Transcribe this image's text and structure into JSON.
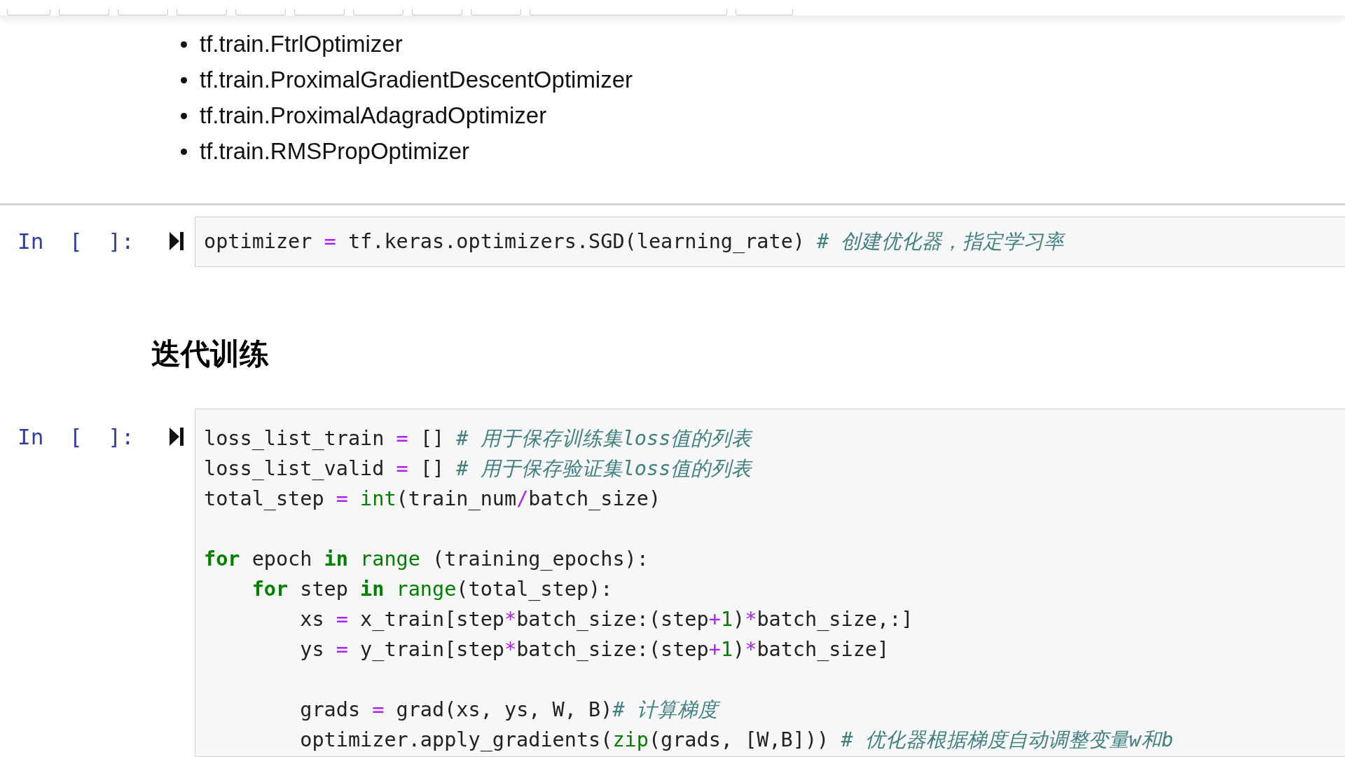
{
  "markdown_cell": {
    "bullets": [
      "tf.train.FtrlOptimizer",
      "tf.train.ProximalGradientDescentOptimizer",
      "tf.train.ProximalAdagradOptimizer",
      "tf.train.RMSPropOptimizer"
    ]
  },
  "cells": [
    {
      "kind": "code",
      "prompt": "In [ ]:",
      "lines": [
        {
          "kind": "code",
          "tokens": [
            {
              "kind": "plain",
              "s": "optimizer "
            },
            {
              "kind": "op",
              "s": "="
            },
            {
              "kind": "plain",
              "s": " tf.keras.optimizers.SGD(learning_rate) "
            },
            {
              "kind": "comment",
              "s": "# 创建优化器，指定学习率"
            }
          ]
        }
      ]
    },
    {
      "kind": "heading",
      "text": "迭代训练"
    },
    {
      "kind": "code",
      "prompt": "In [ ]:",
      "lines": [
        {
          "kind": "code",
          "tokens": [
            {
              "kind": "plain",
              "s": "loss_list_train "
            },
            {
              "kind": "op",
              "s": "="
            },
            {
              "kind": "plain",
              "s": " [] "
            },
            {
              "kind": "comment",
              "s": "# 用于保存训练集loss值的列表"
            }
          ]
        },
        {
          "kind": "code",
          "tokens": [
            {
              "kind": "plain",
              "s": "loss_list_valid "
            },
            {
              "kind": "op",
              "s": "="
            },
            {
              "kind": "plain",
              "s": " [] "
            },
            {
              "kind": "comment",
              "s": "# 用于保存验证集loss值的列表"
            }
          ]
        },
        {
          "kind": "code",
          "tokens": [
            {
              "kind": "plain",
              "s": "total_step "
            },
            {
              "kind": "op",
              "s": "="
            },
            {
              "kind": "builtin",
              "s": " int"
            },
            {
              "kind": "plain",
              "s": "(train_num"
            },
            {
              "kind": "op",
              "s": "/"
            },
            {
              "kind": "plain",
              "s": "batch_size)"
            }
          ]
        },
        {
          "kind": "blank"
        },
        {
          "kind": "code",
          "tokens": [
            {
              "kind": "keyword",
              "s": "for"
            },
            {
              "kind": "plain",
              "s": " epoch "
            },
            {
              "kind": "keyword",
              "s": "in"
            },
            {
              "kind": "builtin",
              "s": " range"
            },
            {
              "kind": "plain",
              "s": " (training_epochs):"
            }
          ]
        },
        {
          "kind": "code",
          "tokens": [
            {
              "kind": "keyword",
              "s": "    for"
            },
            {
              "kind": "plain",
              "s": " step "
            },
            {
              "kind": "keyword",
              "s": "in"
            },
            {
              "kind": "builtin",
              "s": " range"
            },
            {
              "kind": "plain",
              "s": "(total_step):"
            }
          ]
        },
        {
          "kind": "code",
          "tokens": [
            {
              "kind": "plain",
              "s": "        xs "
            },
            {
              "kind": "op",
              "s": "="
            },
            {
              "kind": "plain",
              "s": " x_train[step"
            },
            {
              "kind": "op",
              "s": "*"
            },
            {
              "kind": "plain",
              "s": "batch_size:(step"
            },
            {
              "kind": "op",
              "s": "+"
            },
            {
              "kind": "number",
              "s": "1"
            },
            {
              "kind": "plain",
              "s": ")"
            },
            {
              "kind": "op",
              "s": "*"
            },
            {
              "kind": "plain",
              "s": "batch_size,:]"
            }
          ]
        },
        {
          "kind": "code",
          "tokens": [
            {
              "kind": "plain",
              "s": "        ys "
            },
            {
              "kind": "op",
              "s": "="
            },
            {
              "kind": "plain",
              "s": " y_train[step"
            },
            {
              "kind": "op",
              "s": "*"
            },
            {
              "kind": "plain",
              "s": "batch_size:(step"
            },
            {
              "kind": "op",
              "s": "+"
            },
            {
              "kind": "number",
              "s": "1"
            },
            {
              "kind": "plain",
              "s": ")"
            },
            {
              "kind": "op",
              "s": "*"
            },
            {
              "kind": "plain",
              "s": "batch_size]"
            }
          ]
        },
        {
          "kind": "blank"
        },
        {
          "kind": "code",
          "tokens": [
            {
              "kind": "plain",
              "s": "        grads "
            },
            {
              "kind": "op",
              "s": "="
            },
            {
              "kind": "plain",
              "s": " grad(xs, ys, W, B)"
            },
            {
              "kind": "comment",
              "s": "# 计算梯度"
            }
          ]
        },
        {
          "kind": "code",
          "tokens": [
            {
              "kind": "plain",
              "s": "        optimizer.apply_gradients("
            },
            {
              "kind": "builtin",
              "s": "zip"
            },
            {
              "kind": "plain",
              "s": "(grads, [W,B])) "
            },
            {
              "kind": "comment",
              "s": "# 优化器根据梯度自动调整变量w和b"
            }
          ]
        }
      ]
    }
  ]
}
